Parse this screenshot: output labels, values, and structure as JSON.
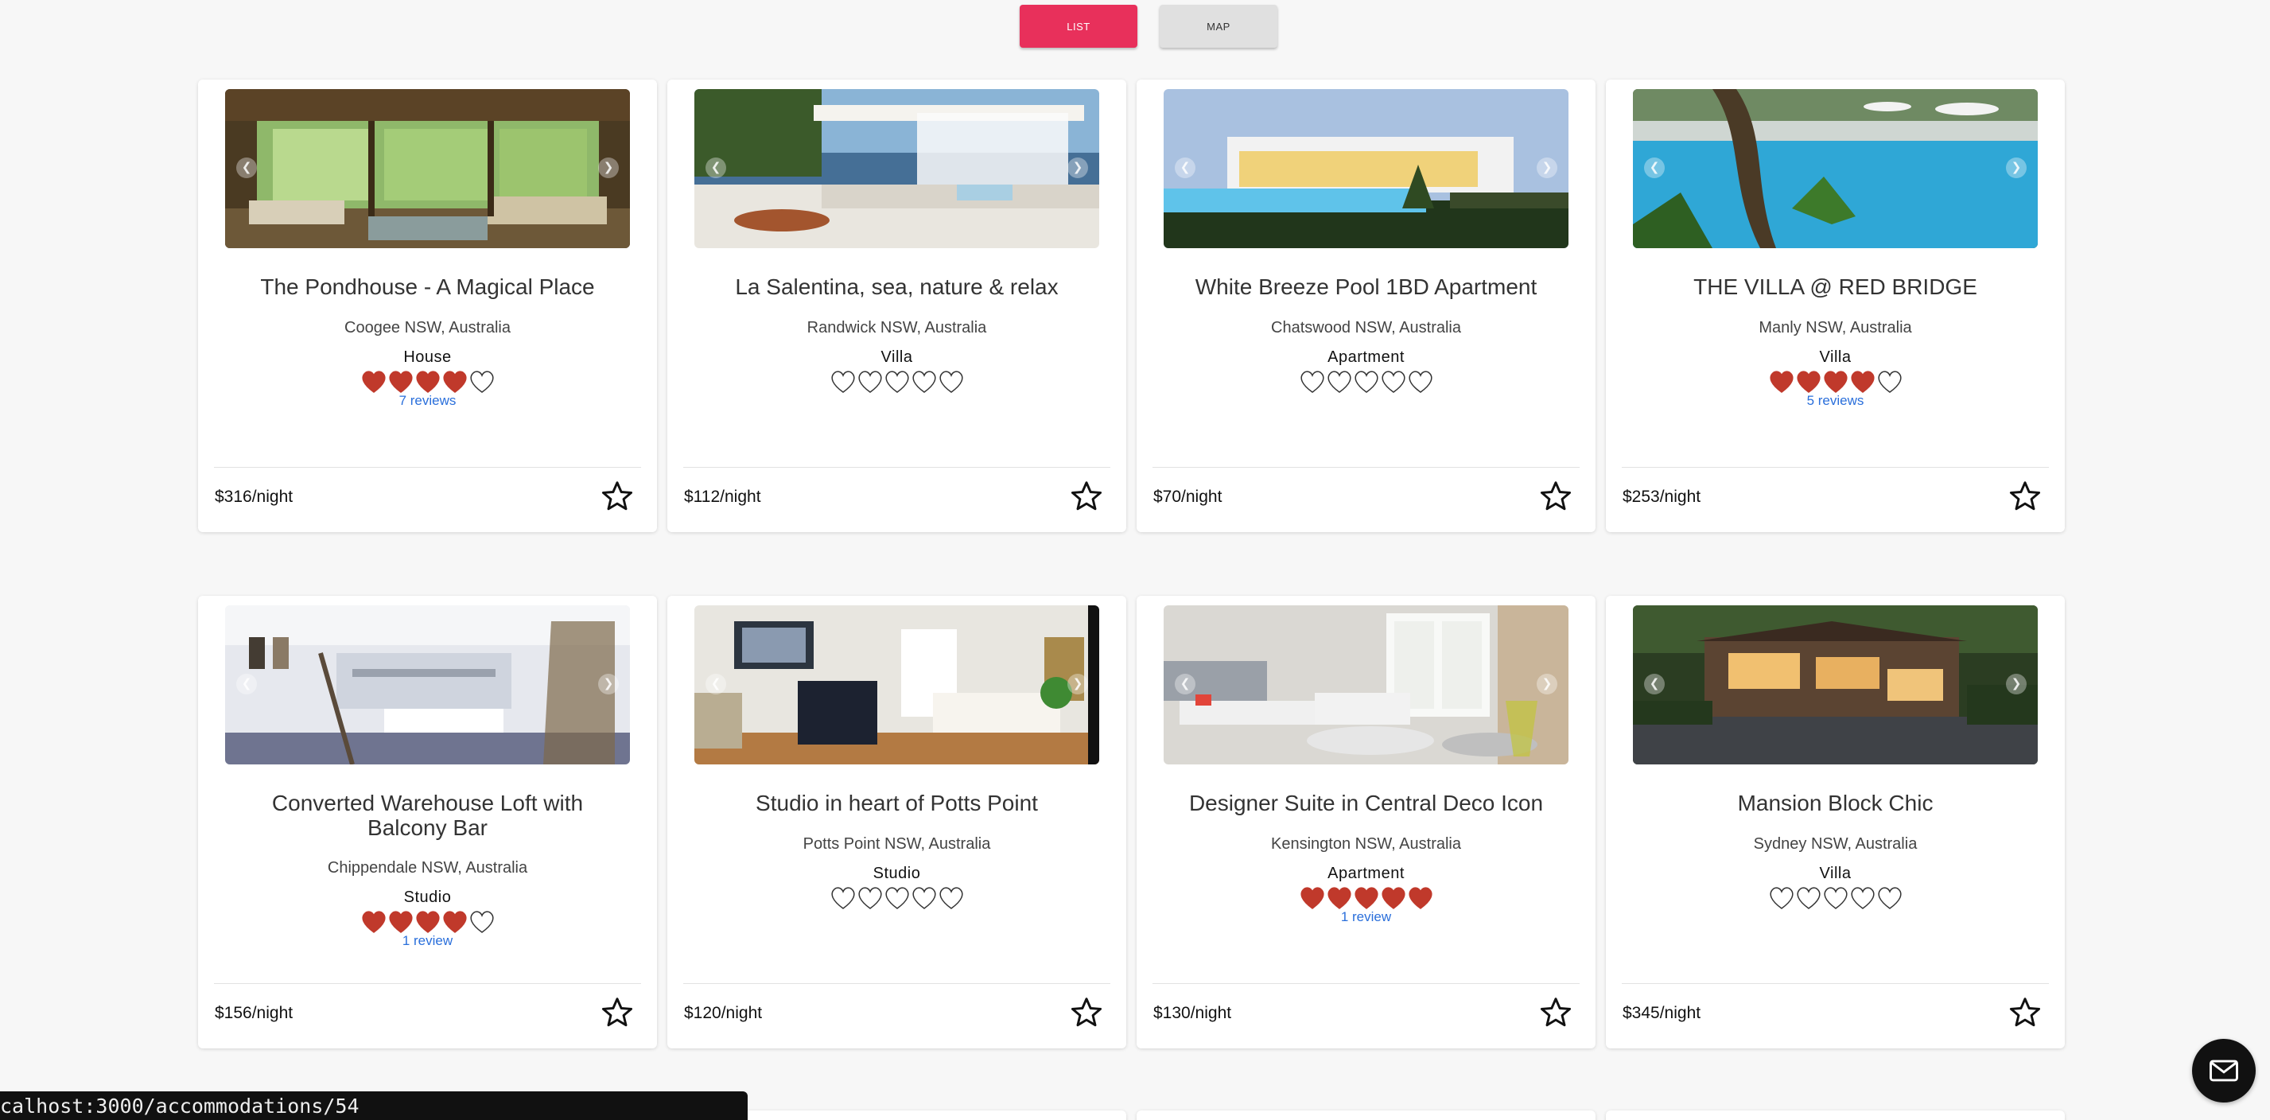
{
  "view_toggle": {
    "list_label": "LIST",
    "map_label": "MAP",
    "active": "LIST"
  },
  "colors": {
    "accent": "#e8305b",
    "heart_filled": "#c0392b",
    "review_link": "#2a6fdb"
  },
  "listings": [
    {
      "title": "The Pondhouse - A Magical Place",
      "location": "Coogee NSW, Australia",
      "type": "House",
      "rating": 4,
      "reviews": "7 reviews",
      "price": "$316/night",
      "image": "rustic-lodge-interior"
    },
    {
      "title": "La Salentina, sea, nature & relax",
      "location": "Randwick NSW, Australia",
      "type": "Villa",
      "rating": 0,
      "reviews": "",
      "price": "$112/night",
      "image": "white-terrace-sea-view"
    },
    {
      "title": "White Breeze Pool 1BD Apartment",
      "location": "Chatswood NSW, Australia",
      "type": "Apartment",
      "rating": 0,
      "reviews": "",
      "price": "$70/night",
      "image": "modern-house-pool-dusk"
    },
    {
      "title": "THE VILLA @ RED BRIDGE",
      "location": "Manly NSW, Australia",
      "type": "Villa",
      "rating": 4,
      "reviews": "5 reviews",
      "price": "$253/night",
      "image": "tropical-pool"
    },
    {
      "title": "Converted Warehouse Loft with Balcony Bar",
      "location": "Chippendale NSW, Australia",
      "type": "Studio",
      "rating": 4,
      "reviews": "1 review",
      "price": "$156/night",
      "image": "white-loft-interior"
    },
    {
      "title": "Studio in heart of Potts Point",
      "location": "Potts Point NSW, Australia",
      "type": "Studio",
      "rating": 0,
      "reviews": "",
      "price": "$120/night",
      "image": "bedroom-studio"
    },
    {
      "title": "Designer Suite in Central Deco Icon",
      "location": "Kensington NSW, Australia",
      "type": "Apartment",
      "rating": 5,
      "reviews": "1 review",
      "price": "$130/night",
      "image": "bright-living-room"
    },
    {
      "title": "Mansion Block Chic",
      "location": "Sydney NSW, Australia",
      "type": "Villa",
      "rating": 0,
      "reviews": "",
      "price": "$345/night",
      "image": "modern-mansion-exterior"
    }
  ],
  "status_bar": {
    "url": "calhost:3000/accommodations/54"
  },
  "icons": {
    "favorite": "star-outline-icon",
    "carousel_prev": "chevron-left-icon",
    "carousel_next": "chevron-right-icon",
    "contact": "mail-icon"
  }
}
